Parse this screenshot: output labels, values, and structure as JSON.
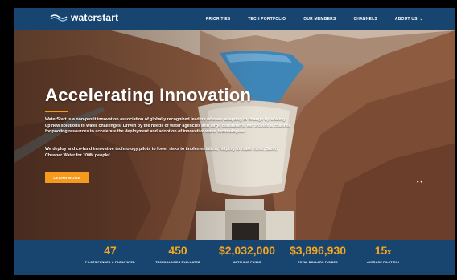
{
  "brand": {
    "logo_text": "waterstart"
  },
  "nav": {
    "items": [
      {
        "label": "PRIORITIES"
      },
      {
        "label": "TECH PORTFOLIO"
      },
      {
        "label": "OUR MEMBERS"
      },
      {
        "label": "CHANNELS"
      },
      {
        "label": "ABOUT US"
      }
    ]
  },
  "hero": {
    "title": "Accelerating Innovation",
    "paragraph1": "WaterStart is a non-profit innovation association of globally recognized leaders who are adapting to change by scaling up new solutions to water challenges. Driven by the needs of water agencies and large consumers, we provide a channel for pooling resources to accelerate the deployment and adoption of innovative water technologies.",
    "paragraph2": "We deploy and co-fund innovative technology pilots to lower risks to implementation, helping to make more, Safer, Cheaper Water for 100M people!",
    "button_label": "LEARN MORE"
  },
  "stats": [
    {
      "value": "47",
      "suffix": "",
      "label": "PILOTS FUNDED & FACILITATED"
    },
    {
      "value": "450",
      "suffix": "",
      "label": "TECHNOLOGIES EVALUATED"
    },
    {
      "value": "$2,032,000",
      "suffix": "",
      "label": "MATCHING FUNDS"
    },
    {
      "value": "$3,896,930",
      "suffix": "",
      "label": "TOTAL DOLLARS FUNDED"
    },
    {
      "value": "15",
      "suffix": "x",
      "label": "AVERAGE PILOT ROI"
    }
  ],
  "colors": {
    "nav_bg": "#17456f",
    "accent": "#f59a1c",
    "stat_value": "#f5a51f"
  }
}
